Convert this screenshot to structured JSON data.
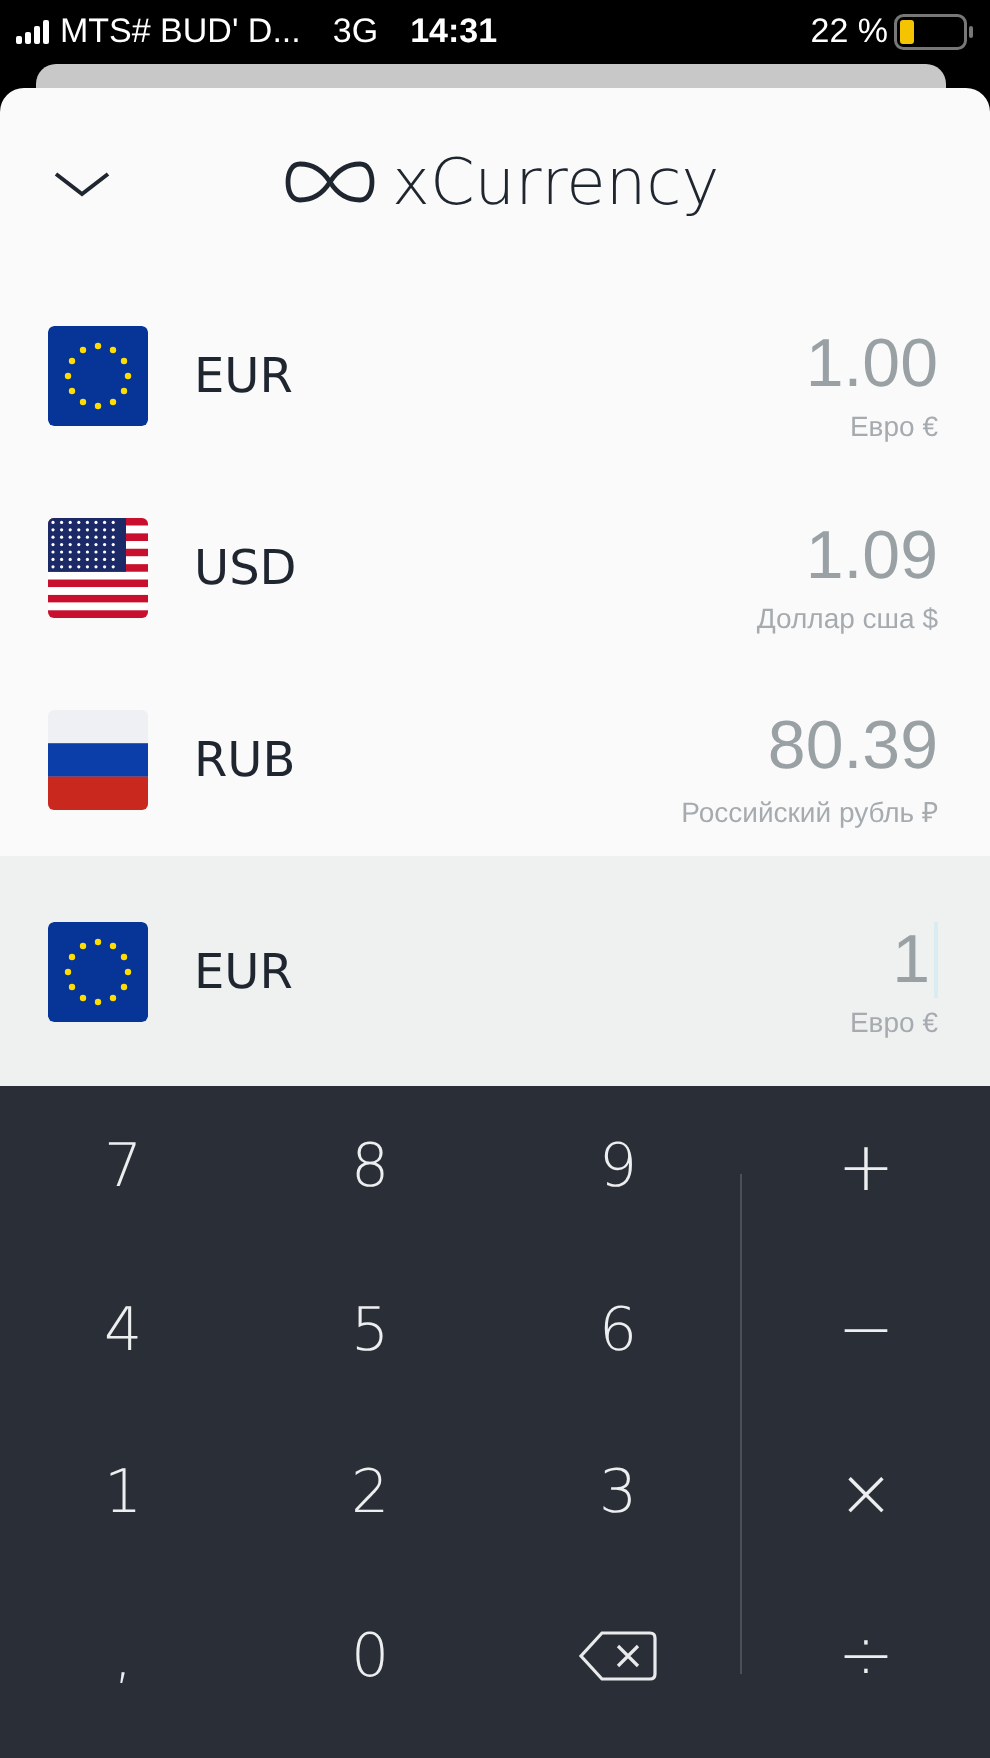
{
  "status_bar": {
    "carrier": "MTS# BUD' D...",
    "network": "3G",
    "time": "14:31",
    "battery": "22 %"
  },
  "header": {
    "title": "xCurrency"
  },
  "currencies": [
    {
      "code": "EUR",
      "kind": "eu",
      "value": "1.00",
      "name": "Евро €",
      "selected": false
    },
    {
      "code": "USD",
      "kind": "us",
      "value": "1.09",
      "name": "Доллар сша $",
      "selected": false
    },
    {
      "code": "RUB",
      "kind": "ru",
      "value": "80.39",
      "name": "Российский рубль ₽",
      "selected": false
    },
    {
      "code": "EUR",
      "kind": "eu",
      "value": "1",
      "name": "Евро €",
      "selected": true
    }
  ],
  "keypad": [
    {
      "kind": "digit",
      "label": "7"
    },
    {
      "kind": "digit",
      "label": "8"
    },
    {
      "kind": "digit",
      "label": "9"
    },
    {
      "kind": "operator",
      "label": "+"
    },
    {
      "kind": "digit",
      "label": "4"
    },
    {
      "kind": "digit",
      "label": "5"
    },
    {
      "kind": "digit",
      "label": "6"
    },
    {
      "kind": "operator",
      "label": "−"
    },
    {
      "kind": "digit",
      "label": "1"
    },
    {
      "kind": "digit",
      "label": "2"
    },
    {
      "kind": "digit",
      "label": "3"
    },
    {
      "kind": "operator",
      "label": "×"
    },
    {
      "kind": "digit",
      "label": ","
    },
    {
      "kind": "digit",
      "label": "0"
    },
    {
      "kind": "backspace"
    },
    {
      "kind": "operator",
      "label": "÷"
    }
  ]
}
